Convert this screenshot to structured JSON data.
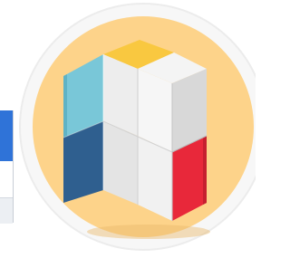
{
  "icon": {
    "name": "cube-icon",
    "colors": {
      "badge_ring": "#f4f4f4",
      "badge_fill": "#fdd38a",
      "cube_top_yellow": "#f9c840",
      "cube_light_blue": "#79c7d8",
      "cube_dark_blue": "#2f5f8f",
      "cube_white": "#f2f2f2",
      "cube_gray": "#d9d9d9",
      "cube_red": "#e8283a"
    }
  },
  "background_window": {
    "title_color": "#2f73d8"
  }
}
